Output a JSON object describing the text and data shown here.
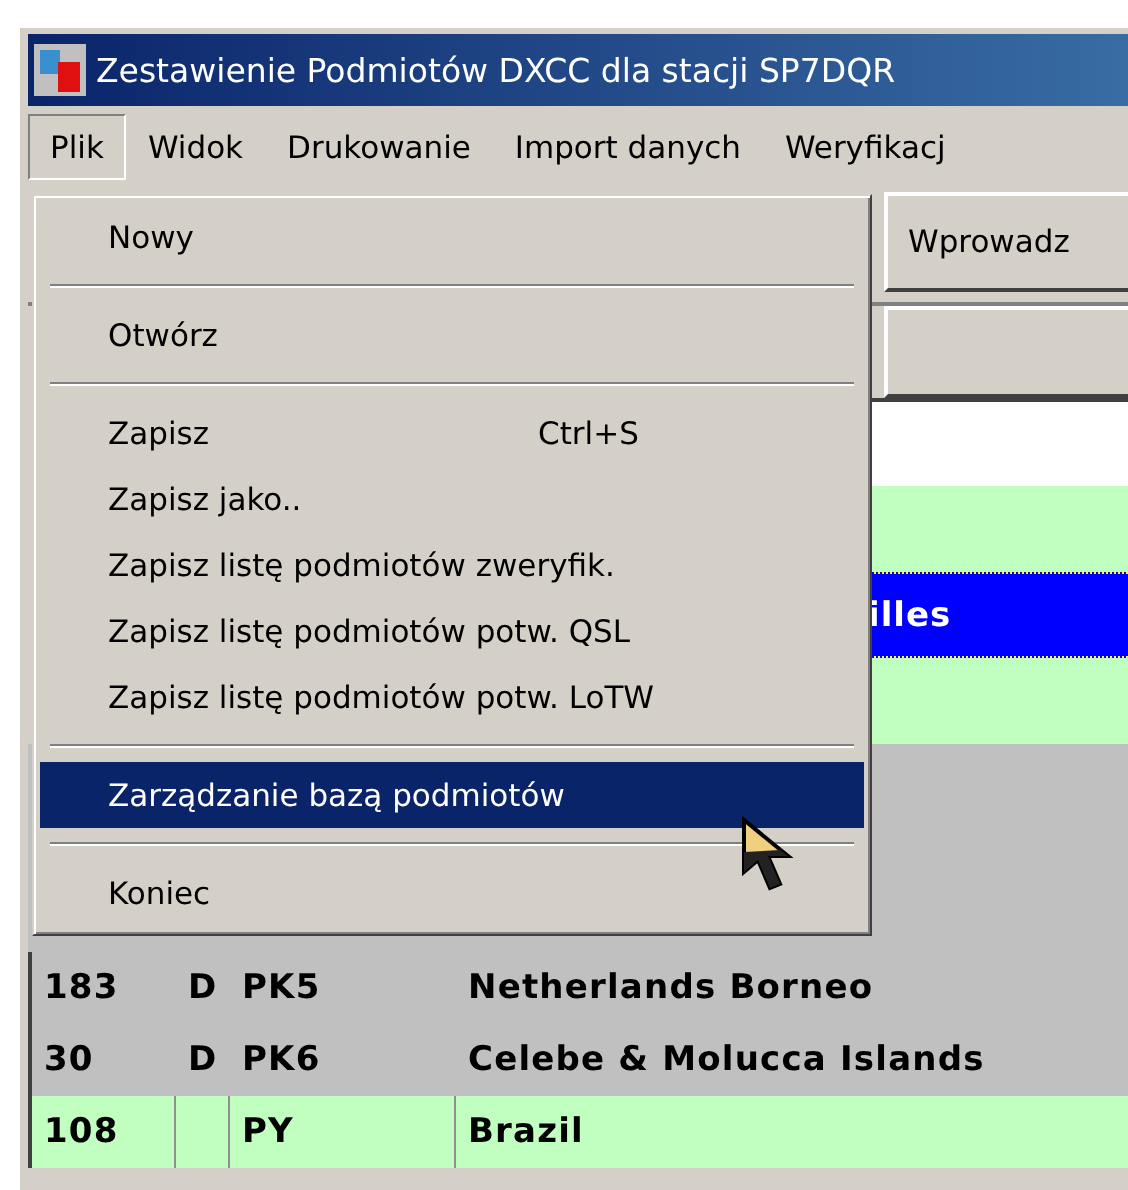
{
  "window": {
    "title": "Zestawienie Podmiotów DXCC dla stacji SP7DQR"
  },
  "menu_bar": [
    {
      "label": "Plik",
      "selected": true
    },
    {
      "label": "Widok",
      "selected": false
    },
    {
      "label": "Drukowanie",
      "selected": false
    },
    {
      "label": "Import danych",
      "selected": false
    },
    {
      "label": "Weryfikacj",
      "selected": false
    }
  ],
  "file_menu": {
    "sections": [
      [
        {
          "label": "Nowy",
          "selected": false
        }
      ],
      [
        {
          "label": "Otwórz",
          "selected": false
        }
      ],
      [
        {
          "label": "Zapisz",
          "shortcut": "Ctrl+S",
          "selected": false
        },
        {
          "label": "Zapisz jako..",
          "selected": false
        },
        {
          "label": "Zapisz listę podmiotów zweryfik.",
          "selected": false
        },
        {
          "label": "Zapisz listę podmiotów potw. QSL",
          "selected": false
        },
        {
          "label": "Zapisz listę podmiotów potw. LoTW",
          "selected": false
        }
      ],
      [
        {
          "label": "Zarządzanie bazą podmiotów",
          "selected": true
        }
      ],
      [
        {
          "label": "Koniec",
          "selected": false
        }
      ]
    ]
  },
  "toolbar": {
    "button": "Wprowadz"
  },
  "upper_rows": [
    {
      "selected": false
    },
    {
      "selected": true,
      "text": "illes"
    },
    {
      "selected": false
    }
  ],
  "table": {
    "rows": [
      {
        "column_1": "183",
        "column_2": "D",
        "column_3": "PK5",
        "column_4": "Netherlands Borneo",
        "deleted": true
      },
      {
        "column_1": "30",
        "column_2": "D",
        "column_3": "PK6",
        "column_4": "Celebe & Molucca Islands",
        "deleted": true
      },
      {
        "column_1": "108",
        "column_3": "PY",
        "column_4": "Brazil",
        "deleted": false
      }
    ]
  }
}
